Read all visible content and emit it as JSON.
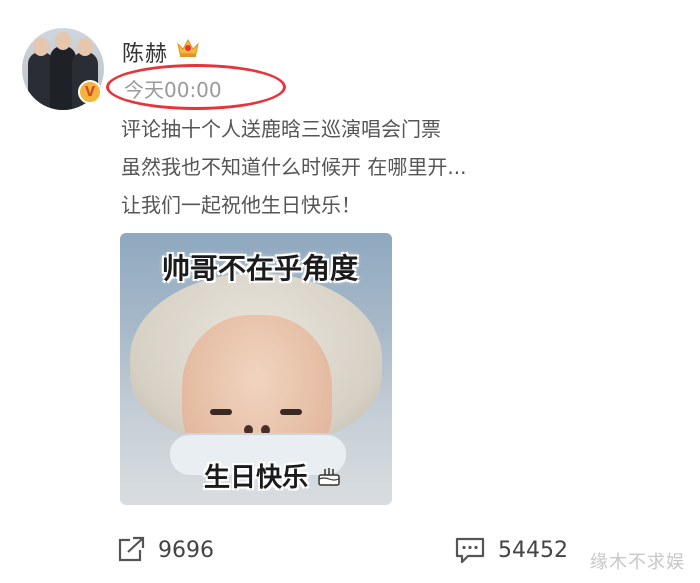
{
  "post": {
    "username": "陈赫",
    "timestamp": "今天00:00",
    "lines": [
      "评论抽十个人送鹿晗三巡演唱会门票",
      "虽然我也不知道什么时候开 在哪里开...",
      "让我们一起祝他生日快乐！"
    ]
  },
  "image": {
    "caption_top": "帅哥不在乎角度",
    "caption_bottom": "生日快乐"
  },
  "actions": {
    "share_count": "9696",
    "comment_count": "54452"
  },
  "watermark": {
    "corner": "缘木不求娱"
  },
  "icons": {
    "verified": "verified-badge-icon",
    "crown": "crown-icon",
    "share": "share-icon",
    "comment": "comment-icon",
    "cake": "cake-icon"
  },
  "colors": {
    "highlight": "#e8333a",
    "verified": "#f6b33a",
    "text_primary": "#333333",
    "text_secondary": "#9a9a9a"
  }
}
